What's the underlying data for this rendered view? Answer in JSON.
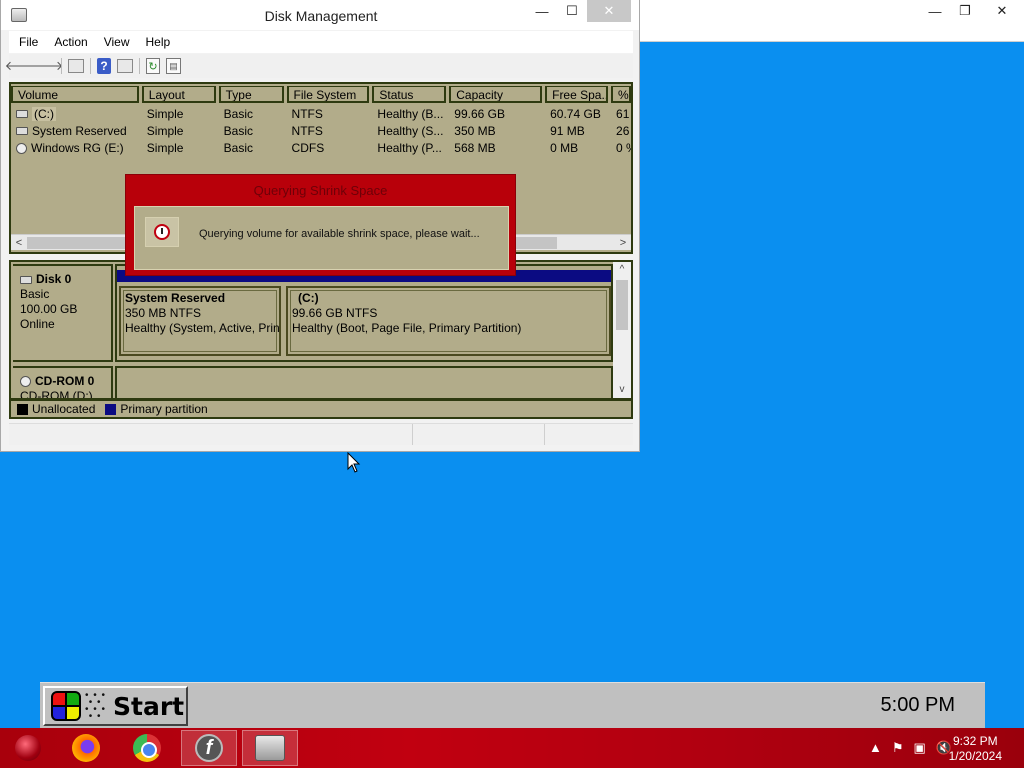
{
  "background_window": {
    "controls": {
      "minimize": "—",
      "restore": "❐",
      "close": "✕"
    }
  },
  "window": {
    "title": "Disk Management",
    "controls": {
      "minimize": "—",
      "maximize": "☐",
      "close": "✕"
    }
  },
  "menu": [
    "File",
    "Action",
    "View",
    "Help"
  ],
  "toolbar": {
    "back": "🡐",
    "forward": "🡒",
    "help": "?",
    "refresh": "↻",
    "properties": "▤"
  },
  "volume_list": {
    "headers": [
      "Volume",
      "Layout",
      "Type",
      "File System",
      "Status",
      "Capacity",
      "Free Spa...",
      "% F"
    ],
    "rows": [
      [
        "(C:)",
        "Simple",
        "Basic",
        "NTFS",
        "Healthy (B...",
        "99.66 GB",
        "60.74 GB",
        "61"
      ],
      [
        "System Reserved",
        "Simple",
        "Basic",
        "NTFS",
        "Healthy (S...",
        "350 MB",
        "91 MB",
        "26"
      ],
      [
        "Windows RG (E:)",
        "Simple",
        "Basic",
        "CDFS",
        "Healthy (P...",
        "568 MB",
        "0 MB",
        "0 %"
      ]
    ],
    "scroll_left": "<",
    "scroll_right": ">"
  },
  "disk_view": {
    "disk0": {
      "name": "Disk 0",
      "type": "Basic",
      "size": "100.00 GB",
      "status": "Online"
    },
    "partitions": [
      {
        "name": "System Reserved",
        "size": "350 MB NTFS",
        "status": "Healthy (System, Active, Prin"
      },
      {
        "name": "(C:)",
        "size": "99.66 GB NTFS",
        "status": "Healthy (Boot, Page File, Primary Partition)"
      }
    ],
    "cdrom": {
      "name": "CD-ROM 0",
      "label": "CD-ROM (D:)"
    },
    "scroll_up": "^",
    "scroll_down": "v"
  },
  "legend": [
    {
      "label": "Unallocated",
      "color": "#000000"
    },
    {
      "label": "Primary partition",
      "color": "#0b0b82"
    }
  ],
  "dialog": {
    "title": "Querying Shrink Space",
    "message": "Querying volume for available shrink space, please wait..."
  },
  "startbar": {
    "start_label": "Start",
    "clock": "5:00 PM"
  },
  "taskbar": {
    "time": "9:32 PM",
    "date": "1/20/2024",
    "apps": [
      "ornament-icon",
      "firefox-icon",
      "chrome-icon",
      "flash-icon",
      "disk-management-icon"
    ]
  },
  "colors": {
    "desktop": "#0a8ff0",
    "panel": "#b2ac8a",
    "dialog": "#b8000a",
    "taskbar": "#b00010",
    "primary_partition": "#0b0b82"
  }
}
